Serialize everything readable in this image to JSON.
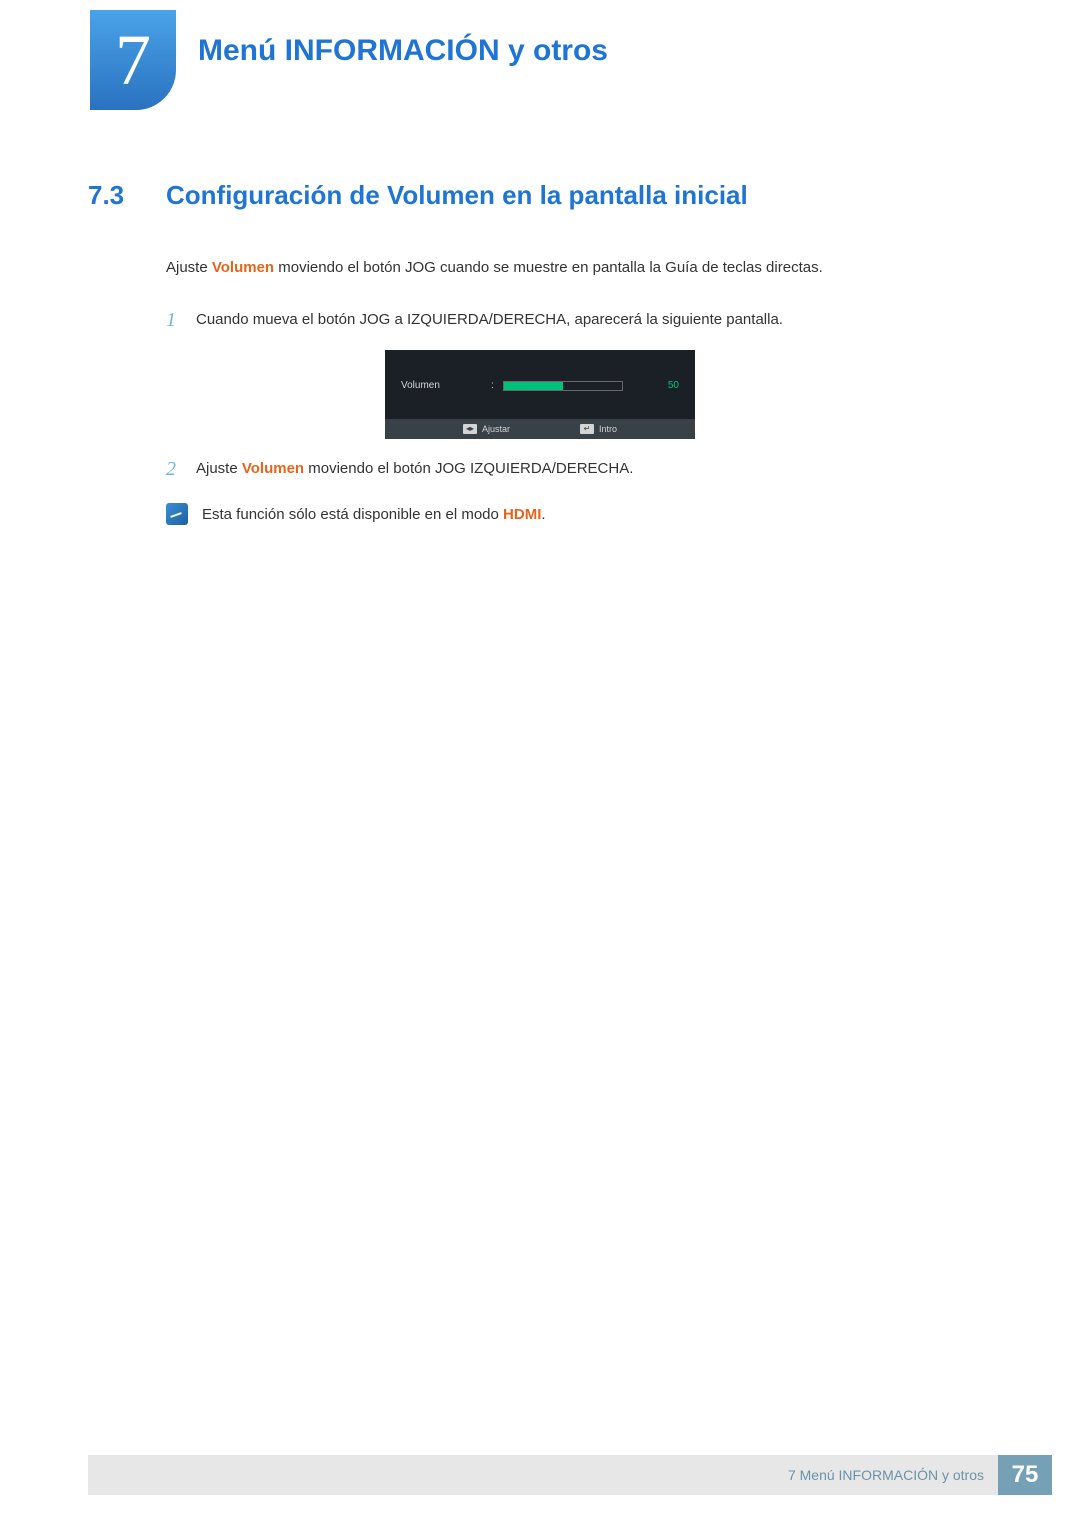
{
  "chapter": {
    "number": "7",
    "title": "Menú INFORMACIÓN y otros"
  },
  "section": {
    "number": "7.3",
    "title": "Configuración de Volumen en la pantalla inicial"
  },
  "intro": {
    "pre": "Ajuste ",
    "bold": "Volumen",
    "post": " moviendo el botón JOG cuando se muestre en pantalla la Guía de teclas directas."
  },
  "steps": [
    {
      "num": "1",
      "text": "Cuando mueva el botón JOG a IZQUIERDA/DERECHA, aparecerá la siguiente pantalla."
    },
    {
      "num": "2",
      "pre": "Ajuste ",
      "bold": "Volumen",
      "post": " moviendo el botón JOG IZQUIERDA/DERECHA."
    }
  ],
  "osd": {
    "label": "Volumen",
    "colon": ":",
    "value": "50",
    "adjust_label": "Ajustar",
    "enter_label": "Intro",
    "adjust_icon": "◂▸",
    "enter_icon": "↵"
  },
  "note": {
    "pre": "Esta función sólo está disponible en el modo ",
    "bold": "HDMI",
    "post": "."
  },
  "footer": {
    "text": "7 Menú INFORMACIÓN y otros",
    "page": "75"
  }
}
